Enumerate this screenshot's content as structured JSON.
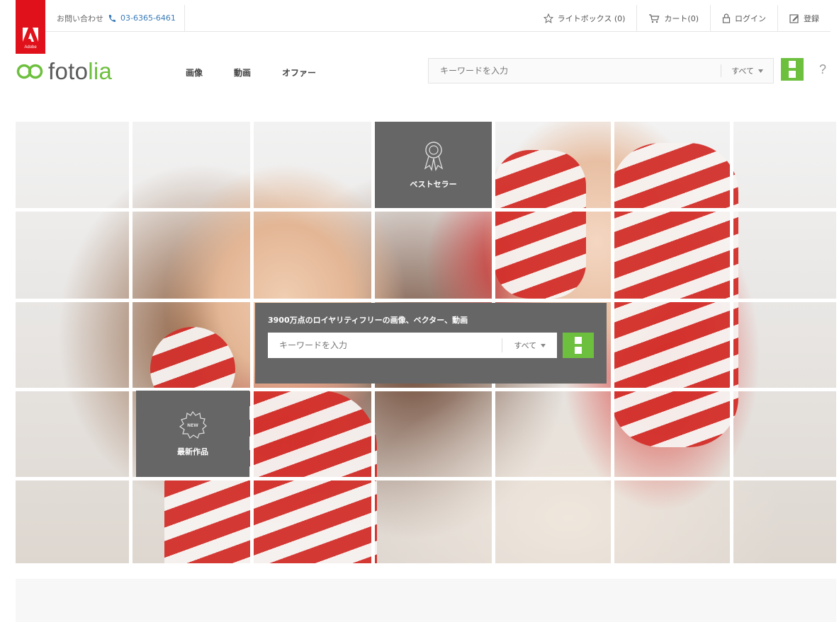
{
  "brand": {
    "adobe_word": "Adobe",
    "logo_text_a": "foto",
    "logo_text_b": "lia",
    "accent": "#6dbf3e",
    "adobe_red": "#e0111a"
  },
  "topbar": {
    "contact_label": "お問い合わせ",
    "phone_icon": "phone-icon",
    "phone_number": "03-6365-6461",
    "lightbox_label": "ライトボックス (0)",
    "cart_label": "カート(0)",
    "login_label": "ログイン",
    "register_label": "登録"
  },
  "nav": {
    "items": [
      "画像",
      "動画",
      "オファー"
    ]
  },
  "search": {
    "placeholder": "キーワードを入力",
    "category": "すべて",
    "help": "?"
  },
  "hero": {
    "title": "3900万点のロイヤリティフリーの画像、ベクター、動画",
    "placeholder": "キーワードを入力",
    "category": "すべて",
    "tile_bestseller": "ベストセラー",
    "tile_new": "最新作品",
    "new_badge": "NEW",
    "tile_color": "#666666"
  }
}
